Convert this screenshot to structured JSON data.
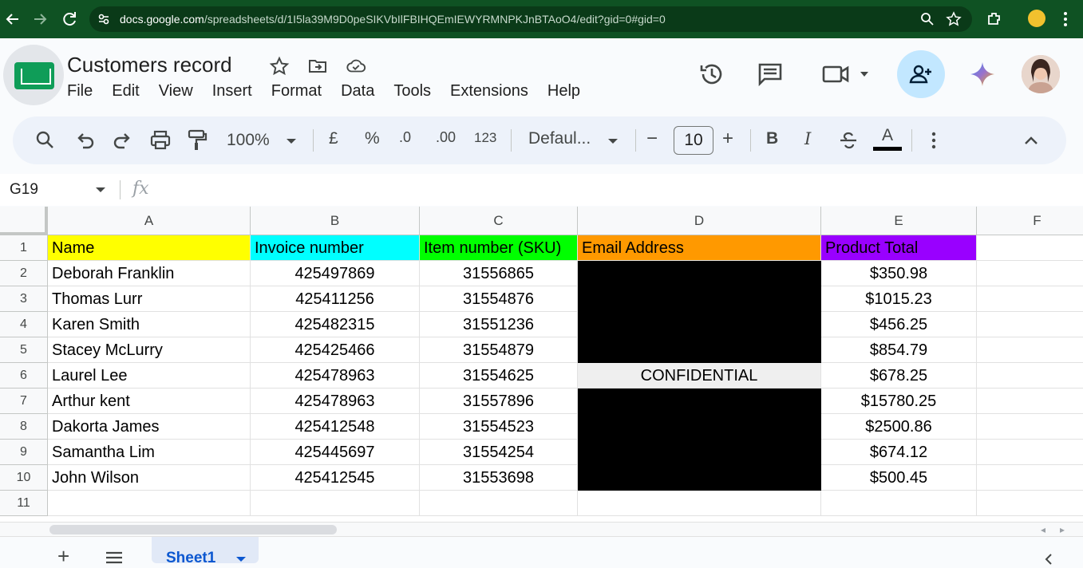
{
  "browser": {
    "url_host": "docs.google.com",
    "url_path": "/spreadsheets/d/1I5la39M9D0peSIKVbIlFBIHQEmIEWYRMNPKJnBTAoO4/edit?gid=0#gid=0"
  },
  "document": {
    "title": "Customers record"
  },
  "menus": [
    "File",
    "Edit",
    "View",
    "Insert",
    "Format",
    "Data",
    "Tools",
    "Extensions",
    "Help"
  ],
  "toolbar": {
    "zoom": "100%",
    "currency": "£",
    "percent": "%",
    "decrease_decimal": ".0",
    "increase_decimal": ".00",
    "number_format": "123",
    "font": "Defaul...",
    "font_size": "10",
    "minus": "−",
    "plus": "+",
    "bold": "B",
    "italic": "I",
    "text_color": "A"
  },
  "formula_bar": {
    "name_box": "G19",
    "fx_label": "fx"
  },
  "grid": {
    "columns": [
      "A",
      "B",
      "C",
      "D",
      "E",
      "F"
    ],
    "rows": [
      "1",
      "2",
      "3",
      "4",
      "5",
      "6",
      "7",
      "8",
      "9",
      "10",
      "11"
    ],
    "header_row": {
      "name": "Name",
      "invoice": "Invoice number",
      "sku": "Item number (SKU)",
      "email": "Email Address",
      "total": "Product Total"
    },
    "header_colors": {
      "name": "#ffff00",
      "invoice": "#00ffff",
      "sku": "#00ff00",
      "email": "#ff9900",
      "total": "#9900ff"
    },
    "records": [
      {
        "name": "Deborah Franklin",
        "invoice": "425497869",
        "sku": "31556865",
        "email": "",
        "total": "$350.98"
      },
      {
        "name": "Thomas Lurr",
        "invoice": "425411256",
        "sku": "31554876",
        "email": "",
        "total": "$1015.23"
      },
      {
        "name": "Karen Smith",
        "invoice": "425482315",
        "sku": "31551236",
        "email": "",
        "total": "$456.25"
      },
      {
        "name": "Stacey McLurry",
        "invoice": "425425466",
        "sku": "31554879",
        "email": "",
        "total": "$854.79"
      },
      {
        "name": "Laurel Lee",
        "invoice": "425478963",
        "sku": "31554625",
        "email": "CONFIDENTIAL",
        "total": "$678.25"
      },
      {
        "name": "Arthur kent",
        "invoice": "425478963",
        "sku": "31557896",
        "email": "",
        "total": "$15780.25"
      },
      {
        "name": "Dakorta James",
        "invoice": "425412548",
        "sku": "31554523",
        "email": "",
        "total": "$2500.86"
      },
      {
        "name": "Samantha Lim",
        "invoice": "425445697",
        "sku": "31554254",
        "email": "",
        "total": "$674.12"
      },
      {
        "name": "John Wilson",
        "invoice": "425412545",
        "sku": "31553698",
        "email": "",
        "total": "$500.45"
      }
    ],
    "email_redaction_color": "#000000",
    "confidential_fill": "#efefef"
  },
  "sheets": [
    {
      "label": "Sheet1",
      "active": true
    }
  ],
  "icons": {
    "back": "back-arrow-icon",
    "forward": "forward-arrow-icon",
    "reload": "reload-icon",
    "site_info": "site-info-icon",
    "zoom": "zoom-icon",
    "bookmark": "star-icon",
    "extensions": "extensions-icon",
    "menu": "kebab-menu-icon"
  }
}
